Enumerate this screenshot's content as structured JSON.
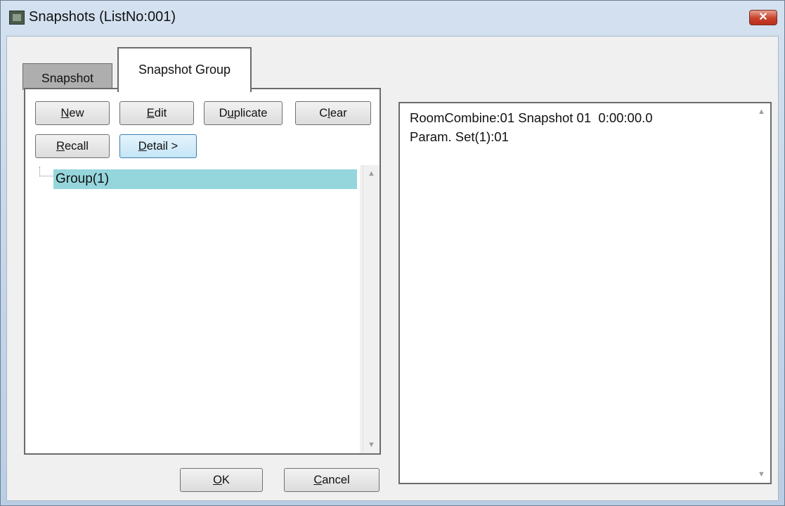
{
  "window": {
    "title": "Snapshots (ListNo:001)",
    "close_label": "✕"
  },
  "tabs": [
    {
      "label": "Snapshot",
      "selected": false
    },
    {
      "label": "Snapshot Group",
      "selected": true
    }
  ],
  "buttons": {
    "new": {
      "pre": "",
      "key": "N",
      "post": "ew"
    },
    "edit": {
      "pre": "",
      "key": "E",
      "post": "dit"
    },
    "duplicate": {
      "pre": "D",
      "key": "u",
      "post": "plicate"
    },
    "clear": {
      "pre": "C",
      "key": "l",
      "post": "ear"
    },
    "recall": {
      "pre": "",
      "key": "R",
      "post": "ecall"
    },
    "detail": {
      "pre": "",
      "key": "D",
      "post": "etail >"
    },
    "ok": {
      "pre": "",
      "key": "O",
      "post": "K"
    },
    "cancel": {
      "pre": "",
      "key": "C",
      "post": "ancel"
    }
  },
  "tree": {
    "items": [
      {
        "label": "Group(1)",
        "selected": true
      }
    ]
  },
  "detail": {
    "lines": [
      "RoomCombine:01 Snapshot 01  0:00:00.0",
      "Param. Set(1):01"
    ]
  },
  "icons": {
    "scroll_up": "▲",
    "scroll_down": "▼"
  },
  "colors": {
    "selection": "#95d6dc",
    "title_bar": "#c6d6e8",
    "close_button": "#c8412b"
  }
}
